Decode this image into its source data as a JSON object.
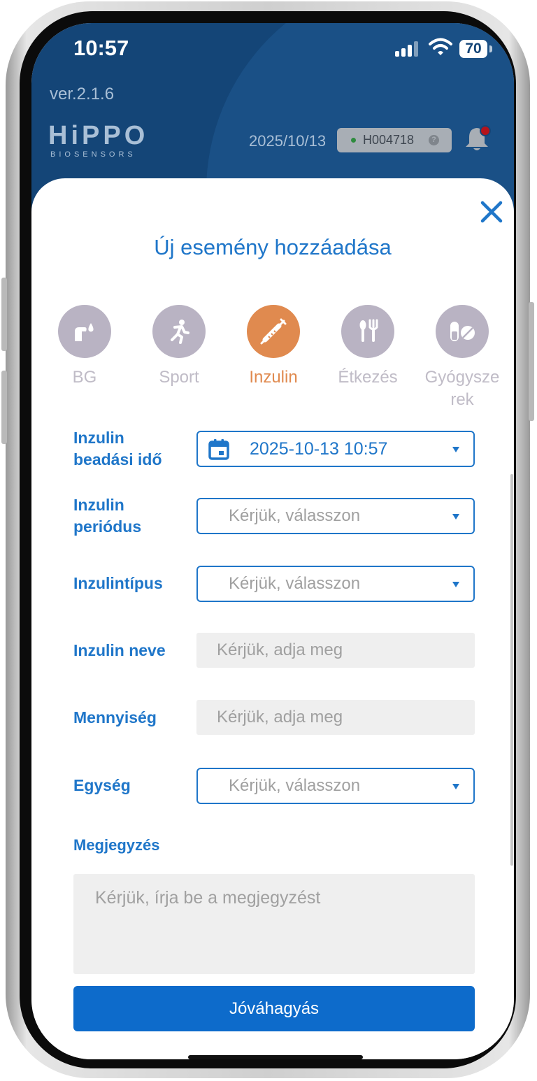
{
  "status_bar": {
    "time": "10:57",
    "battery": "70"
  },
  "header": {
    "version": "ver.2.1.6",
    "logo": "HiPPO",
    "logo_sub": "BIOSENSORS",
    "date": "2025/10/13",
    "device_id": "H004718",
    "device_help": "?"
  },
  "dialog": {
    "title": "Új esemény hozzáadása",
    "categories": [
      {
        "label": "BG",
        "icon": "blood-drop-finger-icon"
      },
      {
        "label": "Sport",
        "icon": "running-icon"
      },
      {
        "label": "Inzulin",
        "icon": "syringe-icon"
      },
      {
        "label": "Étkezés",
        "icon": "fork-knife-icon"
      },
      {
        "label": "Gyógysze\nrek",
        "icon": "pill-icon"
      }
    ],
    "active_category": "Inzulin",
    "fields": {
      "time": {
        "label": "Inzulin\nbeadási idő",
        "value": "2025-10-13 10:57"
      },
      "period": {
        "label": "Inzulin\nperiódus",
        "placeholder": "Kérjük, válasszon"
      },
      "type": {
        "label": "Inzulintípus",
        "placeholder": "Kérjük, válasszon"
      },
      "name": {
        "label": "Inzulin neve",
        "placeholder": "Kérjük, adja meg"
      },
      "amount": {
        "label": "Mennyiség",
        "placeholder": "Kérjük, adja meg"
      },
      "unit": {
        "label": "Egység",
        "placeholder": "Kérjük, válasszon"
      },
      "note": {
        "label": "Megjegyzés",
        "placeholder": "Kérjük, írja be a megjegyzést"
      }
    },
    "confirm_label": "Jóváhagyás"
  },
  "colors": {
    "header_bg": "#144577",
    "accent": "#1f76c9",
    "active_category": "#e08a4f",
    "inactive_category": "#b9b3c3",
    "button": "#0d6bcb",
    "notification_dot": "#b3131b"
  }
}
